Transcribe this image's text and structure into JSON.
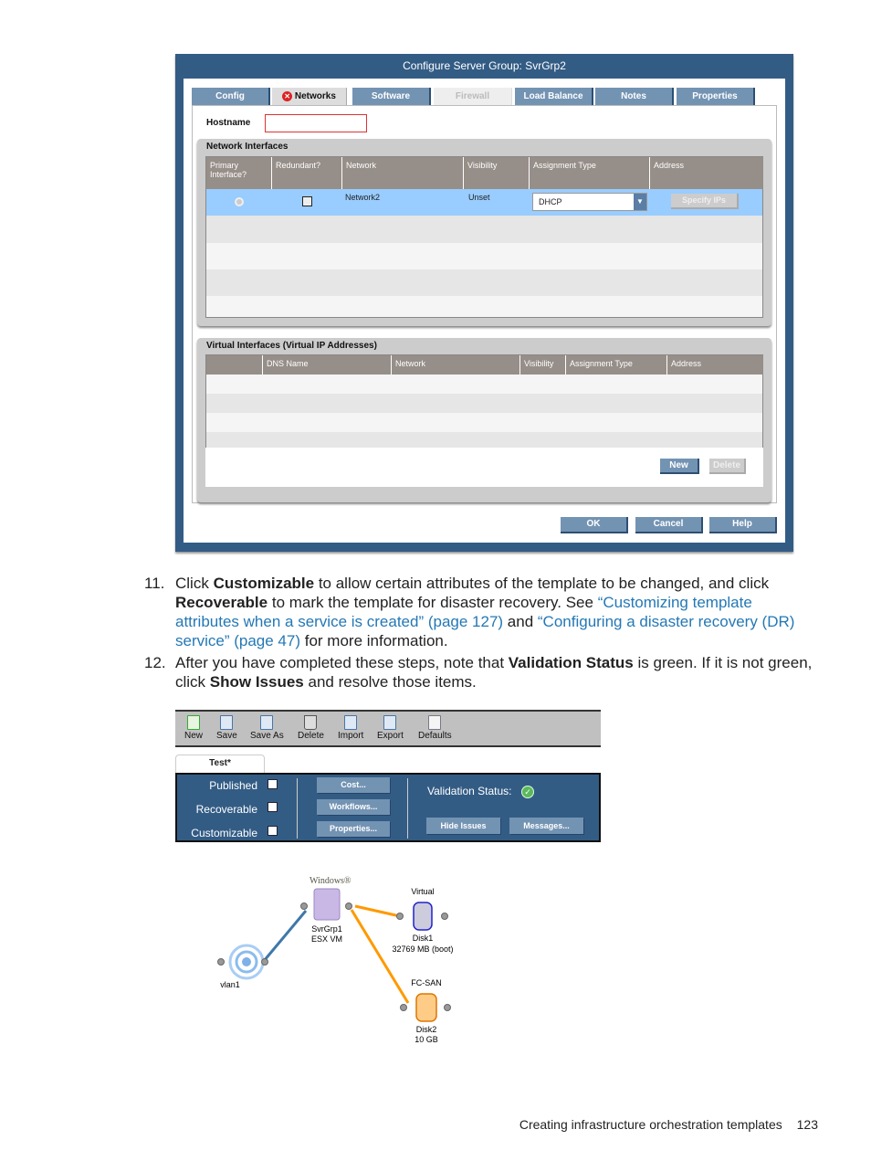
{
  "dialog": {
    "title": "Configure Server Group: SvrGrp2",
    "tabs": [
      {
        "label": "Config",
        "state": "normal"
      },
      {
        "label": "Networks",
        "state": "active",
        "icon": "error-icon"
      },
      {
        "label": "Software",
        "state": "normal"
      },
      {
        "label": "Firewall",
        "state": "disabled"
      },
      {
        "label": "Load Balance",
        "state": "normal"
      },
      {
        "label": "Notes",
        "state": "normal"
      },
      {
        "label": "Properties",
        "state": "normal"
      }
    ],
    "hostname_label": "Hostname",
    "hostname_value": "",
    "network_interfaces": {
      "title": "Network Interfaces",
      "columns": [
        "Primary Interface?",
        "Redundant?",
        "Network",
        "Visibility",
        "Assignment Type",
        "Address"
      ],
      "rows": [
        {
          "primary": "radio",
          "redundant": false,
          "network": "Network2",
          "visibility": "Unset",
          "assignment_type": "DHCP",
          "address_button": "Specify IPs"
        }
      ]
    },
    "virtual_interfaces": {
      "title": "Virtual Interfaces (Virtual IP Addresses)",
      "columns": [
        "",
        "DNS Name",
        "Network",
        "Visibility",
        "Assignment Type",
        "Address"
      ],
      "new_label": "New",
      "delete_label": "Delete"
    },
    "ok_label": "OK",
    "cancel_label": "Cancel",
    "help_label": "Help",
    "colors": {
      "frame": "#335c85",
      "button": "#7393b3",
      "selected_row": "#99ccff",
      "table_header": "#968e88"
    }
  },
  "steps": [
    {
      "number": "11.",
      "t1": "Click ",
      "b1": "Customizable",
      "t2": " to allow certain attributes of the template to be changed, and click ",
      "b2": "Recoverable",
      "t3": " to mark the template for disaster recovery. See ",
      "link1": "“Customizing template attributes when a service is created” (page 127)",
      "t4": " and ",
      "link2": "“Configuring a disaster recovery (DR) service” (page 47)",
      "t5": " for more information."
    },
    {
      "number": "12.",
      "t1": "After you have completed these steps, note that ",
      "b1": "Validation Status",
      "t2": " is green. If it is not green, click ",
      "b2": "Show Issues",
      "t3": " and resolve those items."
    }
  ],
  "editor": {
    "toolbar": [
      "New",
      "Save",
      "Save As",
      "Delete",
      "Import",
      "Export",
      "Defaults"
    ],
    "tab_label": "Test*",
    "checkboxes": [
      {
        "label": "Published",
        "checked": false
      },
      {
        "label": "Recoverable",
        "checked": false
      },
      {
        "label": "Customizable",
        "checked": false
      }
    ],
    "buttons": [
      "Cost...",
      "Workflows...",
      "Properties..."
    ],
    "validation_label": "Validation Status:",
    "validation_state": "green",
    "hide_issues_label": "Hide Issues",
    "messages_label": "Messages..."
  },
  "diagram": {
    "os_logo": "Windows®",
    "server_name": "SvrGrp1",
    "server_type": "ESX VM",
    "network_name": "vlan1",
    "disk1_type": "Virtual",
    "disk1_name": "Disk1",
    "disk1_size": "32769 MB (boot)",
    "disk2_type": "FC-SAN",
    "disk2_name": "Disk2",
    "disk2_size": "10 GB"
  },
  "footer": {
    "title": "Creating infrastructure orchestration templates",
    "page": "123"
  }
}
